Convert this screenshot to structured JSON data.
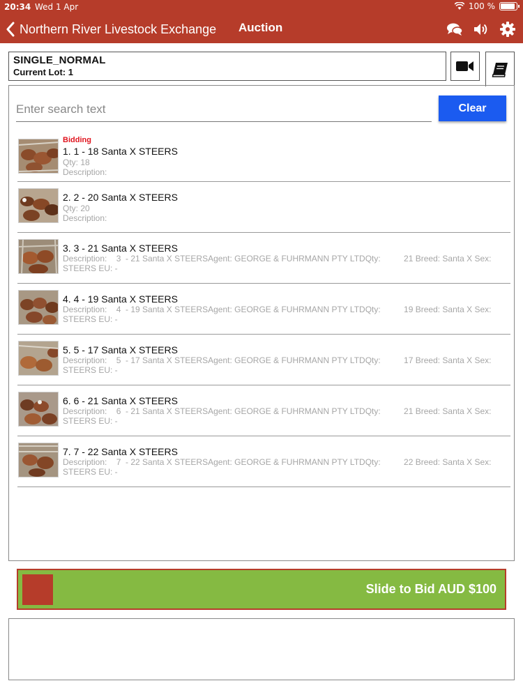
{
  "status_bar": {
    "time": "20:34",
    "date": "Wed 1 Apr",
    "battery": "100 %",
    "battery_level": 1.0
  },
  "nav": {
    "back_label": "Northern River Livestock Exchange",
    "title": "Auction",
    "icons": [
      "chat-icon",
      "speaker-icon",
      "gear-icon"
    ]
  },
  "lot_header": {
    "mode": "SINGLE_NORMAL",
    "current_lot": "Current Lot: 1"
  },
  "header_buttons": {
    "video_icon": "video-camera-icon",
    "book_icon": "book-icon"
  },
  "search": {
    "placeholder": "Enter search text",
    "value": ""
  },
  "clear_label": "Clear",
  "lots": [
    {
      "status": "Bidding",
      "title": "1. 1  - 18 Santa X STEERS",
      "qty": "Qty: 18",
      "description": "Description:"
    },
    {
      "title": "2. 2  - 20 Santa X STEERS",
      "qty": "Qty: 20",
      "description": "Description:"
    },
    {
      "title": "3. 3  - 21 Santa X STEERS",
      "details": "Description:    3  - 21 Santa X STEERSAgent: GEORGE & FUHRMANN PTY LTDQty:          21 Breed: Santa X Sex:\nSTEERS EU: -"
    },
    {
      "title": "4. 4  - 19 Santa X STEERS",
      "details": "Description:    4  - 19 Santa X STEERSAgent: GEORGE & FUHRMANN PTY LTDQty:          19 Breed: Santa X Sex:\nSTEERS EU: -"
    },
    {
      "title": "5. 5  - 17 Santa X STEERS",
      "details": "Description:    5  - 17 Santa X STEERSAgent: GEORGE & FUHRMANN PTY LTDQty:          17 Breed: Santa X Sex:\nSTEERS EU: -"
    },
    {
      "title": "6. 6  - 21 Santa X STEERS",
      "details": "Description:    6  - 21 Santa X STEERSAgent: GEORGE & FUHRMANN PTY LTDQty:          21 Breed: Santa X Sex:\nSTEERS EU: -"
    },
    {
      "title": "7. 7  - 22 Santa X STEERS",
      "details": "Description:    7  - 22 Santa X STEERSAgent: GEORGE & FUHRMANN PTY LTDQty:          22 Breed: Santa X Sex:\nSTEERS EU: -"
    }
  ],
  "slide_to_bid": {
    "label": "Slide to Bid AUD $100"
  },
  "colors": {
    "brand_red": "#b63c2a",
    "clear_blue": "#1b5bf0",
    "slide_green": "#85ba42",
    "bidding_red": "#e0141e"
  }
}
